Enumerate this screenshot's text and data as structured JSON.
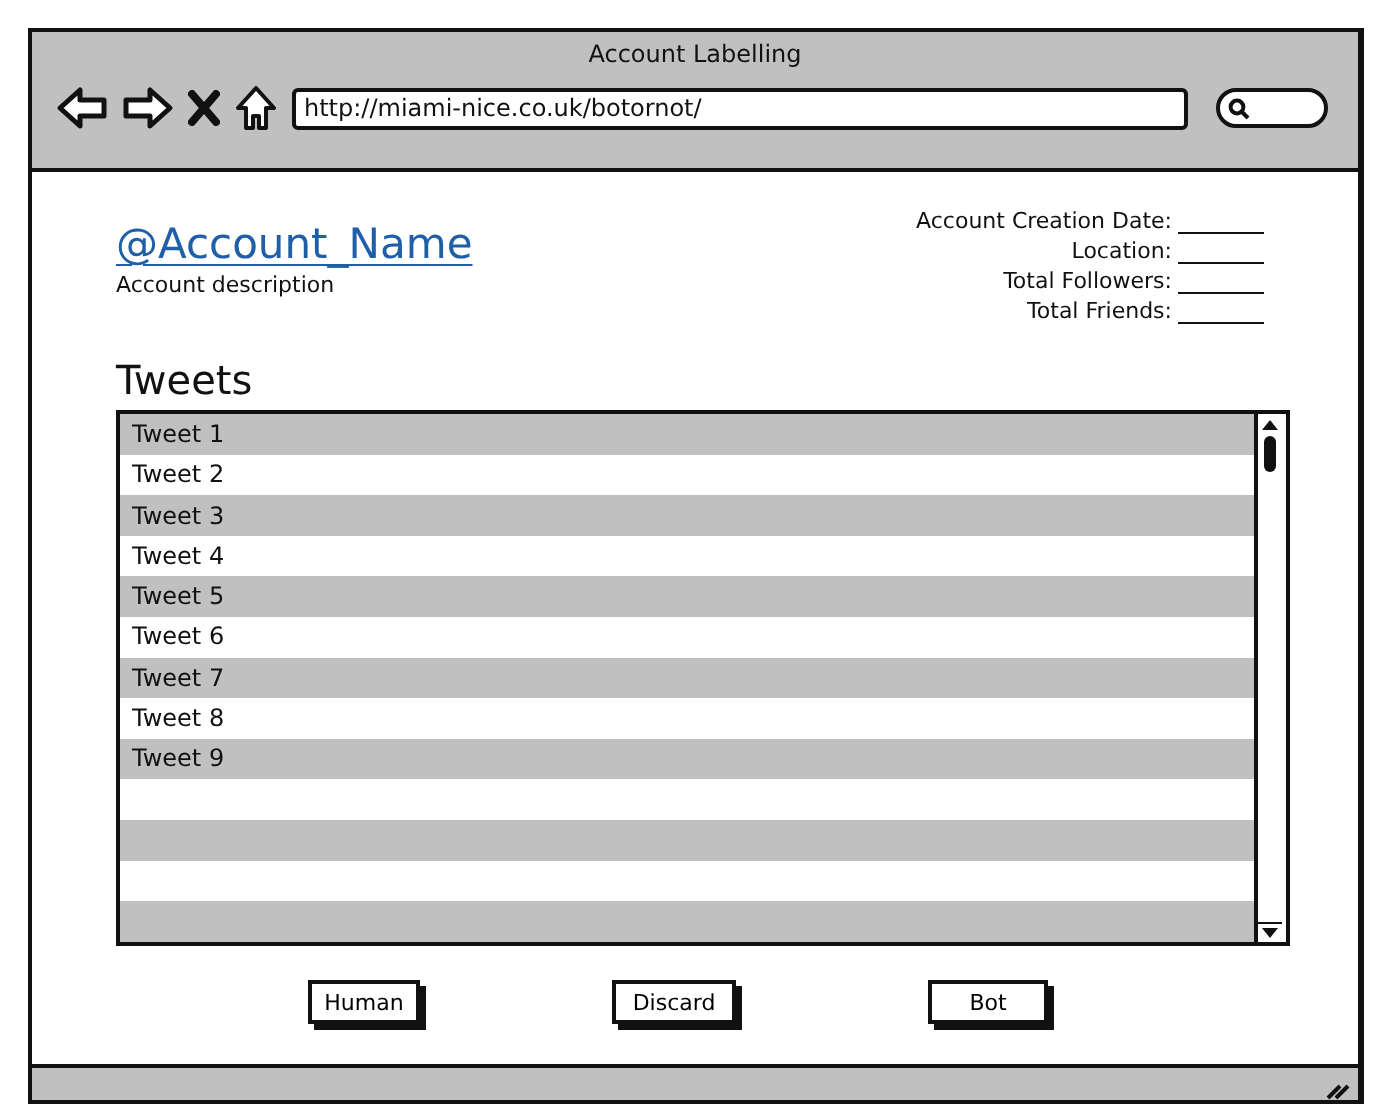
{
  "window": {
    "title": "Account Labelling"
  },
  "browser": {
    "url": "http://miami-nice.co.uk/botornot/"
  },
  "account": {
    "name": "@Account_Name",
    "description": "Account description"
  },
  "fields": [
    {
      "label": "Account Creation Date:"
    },
    {
      "label": "Location:"
    },
    {
      "label": "Total Followers:"
    },
    {
      "label": "Total Friends:"
    }
  ],
  "tweets_title": "Tweets",
  "tweets": [
    "Tweet 1",
    "Tweet 2",
    "Tweet 3",
    "Tweet 4",
    "Tweet 5",
    "Tweet 6",
    "Tweet 7",
    "Tweet 8",
    "Tweet 9"
  ],
  "buttons": [
    "Human",
    "Discard",
    "Bot"
  ]
}
